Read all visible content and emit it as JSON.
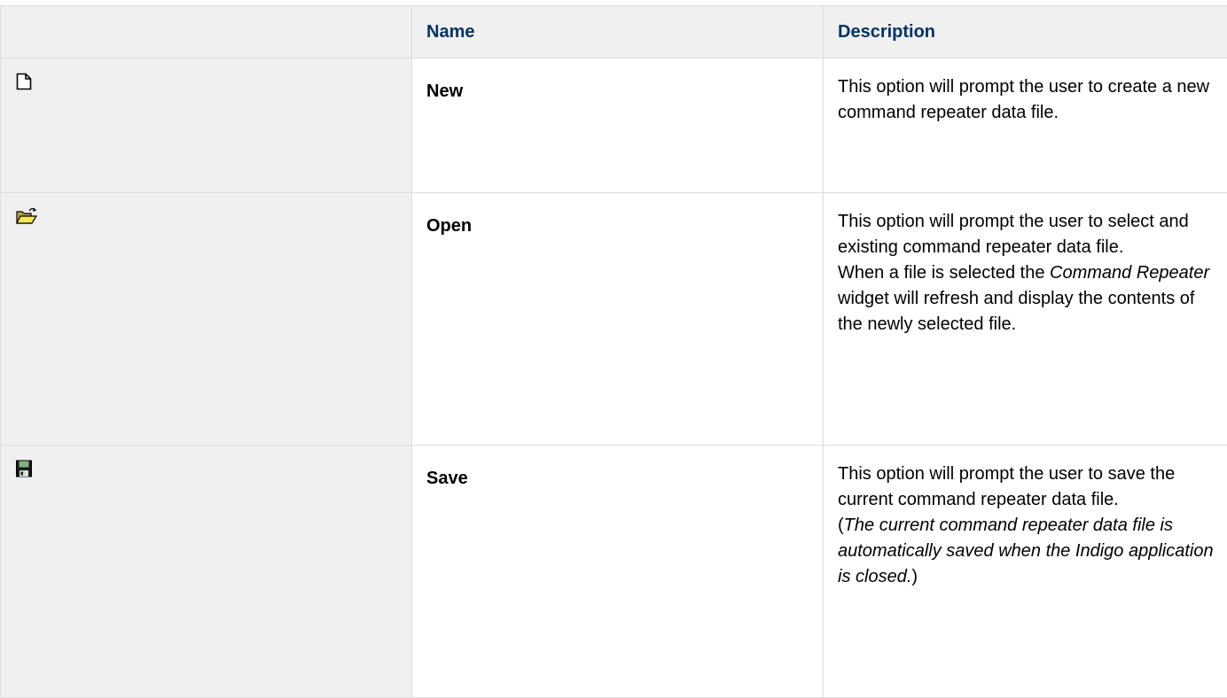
{
  "table": {
    "headers": {
      "icon": "",
      "name": "Name",
      "description": "Description"
    },
    "rows": [
      {
        "icon": "new-file-icon",
        "name": "New",
        "description": {
          "line1": "This option will prompt the user to create a new command repeater data file."
        }
      },
      {
        "icon": "open-folder-icon",
        "name": "Open",
        "description": {
          "line1": "This option will prompt the user to select and existing command repeater data file.",
          "line2_prefix": "When a file is selected the ",
          "line2_em": "Command Repeater",
          "line2_suffix": " widget will refresh and display the contents of the newly selected file."
        }
      },
      {
        "icon": "save-disk-icon",
        "name": "Save",
        "description": {
          "line1": "This option will prompt the user to save the current command repeater data file.",
          "line2_open": "(",
          "line2_em": "The current command repeater data file is automatically saved when the Indigo application is closed.",
          "line2_close": ")"
        }
      }
    ]
  },
  "colors": {
    "header_text": "#003366",
    "header_bg": "#f0f0f0",
    "border": "#dddddd"
  }
}
